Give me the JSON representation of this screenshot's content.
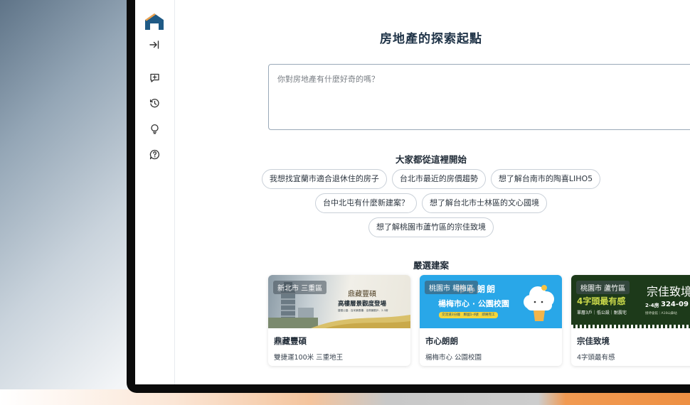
{
  "app": {
    "title": "房地產的探索起點",
    "search": {
      "placeholder": "你對房地產有什麼好奇的嗎？",
      "value": ""
    }
  },
  "sidebar": {
    "items": [
      {
        "name": "collapse-sidebar",
        "icon": "arrow-to-right-icon"
      },
      {
        "name": "new-chat",
        "icon": "chat-plus-icon"
      },
      {
        "name": "history",
        "icon": "history-icon"
      },
      {
        "name": "tips",
        "icon": "lightbulb-icon"
      },
      {
        "name": "help",
        "icon": "question-bubble-icon"
      }
    ]
  },
  "suggestions": {
    "heading": "大家都從這裡開始",
    "rows": [
      [
        "我想找宜蘭市適合退休住的房子",
        "台北市最近的房價趨勢",
        "想了解台南市的陶喜LIHO5"
      ],
      [
        "台中北屯有什麼新建案？",
        "想了解台北市士林區的文心國境"
      ],
      [
        "想了解桃園市蘆竹區的宗佳致境"
      ]
    ]
  },
  "featured": {
    "heading": "嚴選建案",
    "cards": [
      {
        "tag": "新北市 三重區",
        "name": "鼎藏豐碩",
        "subtitle": "雙捷運100米 三重地王",
        "banner": {
          "brand": "鼎藏豐碩",
          "headline": "高樓層景觀度登場",
          "small": "捷運公園．百米景觀樓．全周景觀戶．2-3房"
        }
      },
      {
        "tag": "桃園市 楊梅區",
        "name": "市心朗朗",
        "subtitle": "楊梅市心 公園校園",
        "banner": {
          "brand": "市心朗朗",
          "headline": "楊梅市心 · 公園校園",
          "small": "交流道3分鐘　鄰國1-4號　即將完工"
        }
      },
      {
        "tag": "桃園市 蘆竹區",
        "name": "宗佳致境",
        "subtitle": "4字頭最有感",
        "banner": {
          "brand": "宗佳致境",
          "headline": "4字頭最有感",
          "rooms": "2-4房",
          "phone": "324-09",
          "small": "單層3戶｜低公設｜耐震宅",
          "tiny": "接待會館｜A10山鼻站"
        }
      }
    ]
  },
  "colors": {
    "brand": "#1f5a85",
    "accent": "#f0a14a",
    "title": "#1f3347"
  }
}
